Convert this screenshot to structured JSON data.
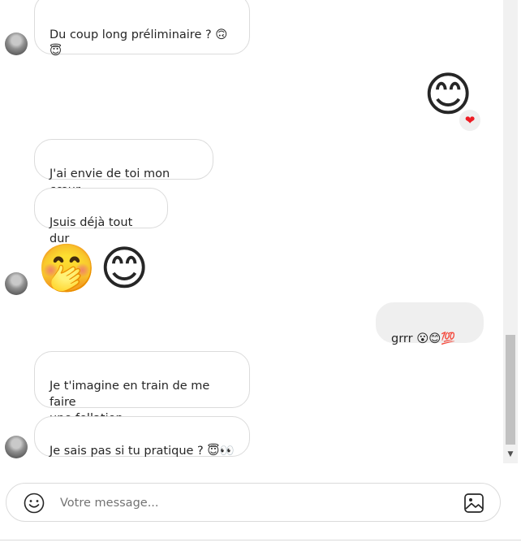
{
  "messages": [
    {
      "id": "m1",
      "text": "Du coup long préliminaire ? 🙃\n😇"
    },
    {
      "id": "m2",
      "emoji": "😊",
      "reaction": "❤"
    },
    {
      "id": "m3",
      "text": "J'ai envie de toi mon cœur"
    },
    {
      "id": "m4",
      "text": "Jsuis déjà tout dur"
    },
    {
      "id": "m5",
      "emojis": [
        "🤭",
        "😊"
      ]
    },
    {
      "id": "m6",
      "text": "grrr 😮😊💯"
    },
    {
      "id": "m7",
      "text": "Je t'imagine en train de me faire\nune fellation"
    },
    {
      "id": "m8",
      "text": "Je sais pas si tu pratique ? 😇👀"
    }
  ],
  "composer": {
    "placeholder": "Votre message...",
    "emoji_icon": "smiley-face-icon",
    "media_icon": "image-icon"
  },
  "colors": {
    "incoming_border": "#dbdbdb",
    "outgoing_bg": "#efefef",
    "reaction_heart": "#ed1c24"
  }
}
